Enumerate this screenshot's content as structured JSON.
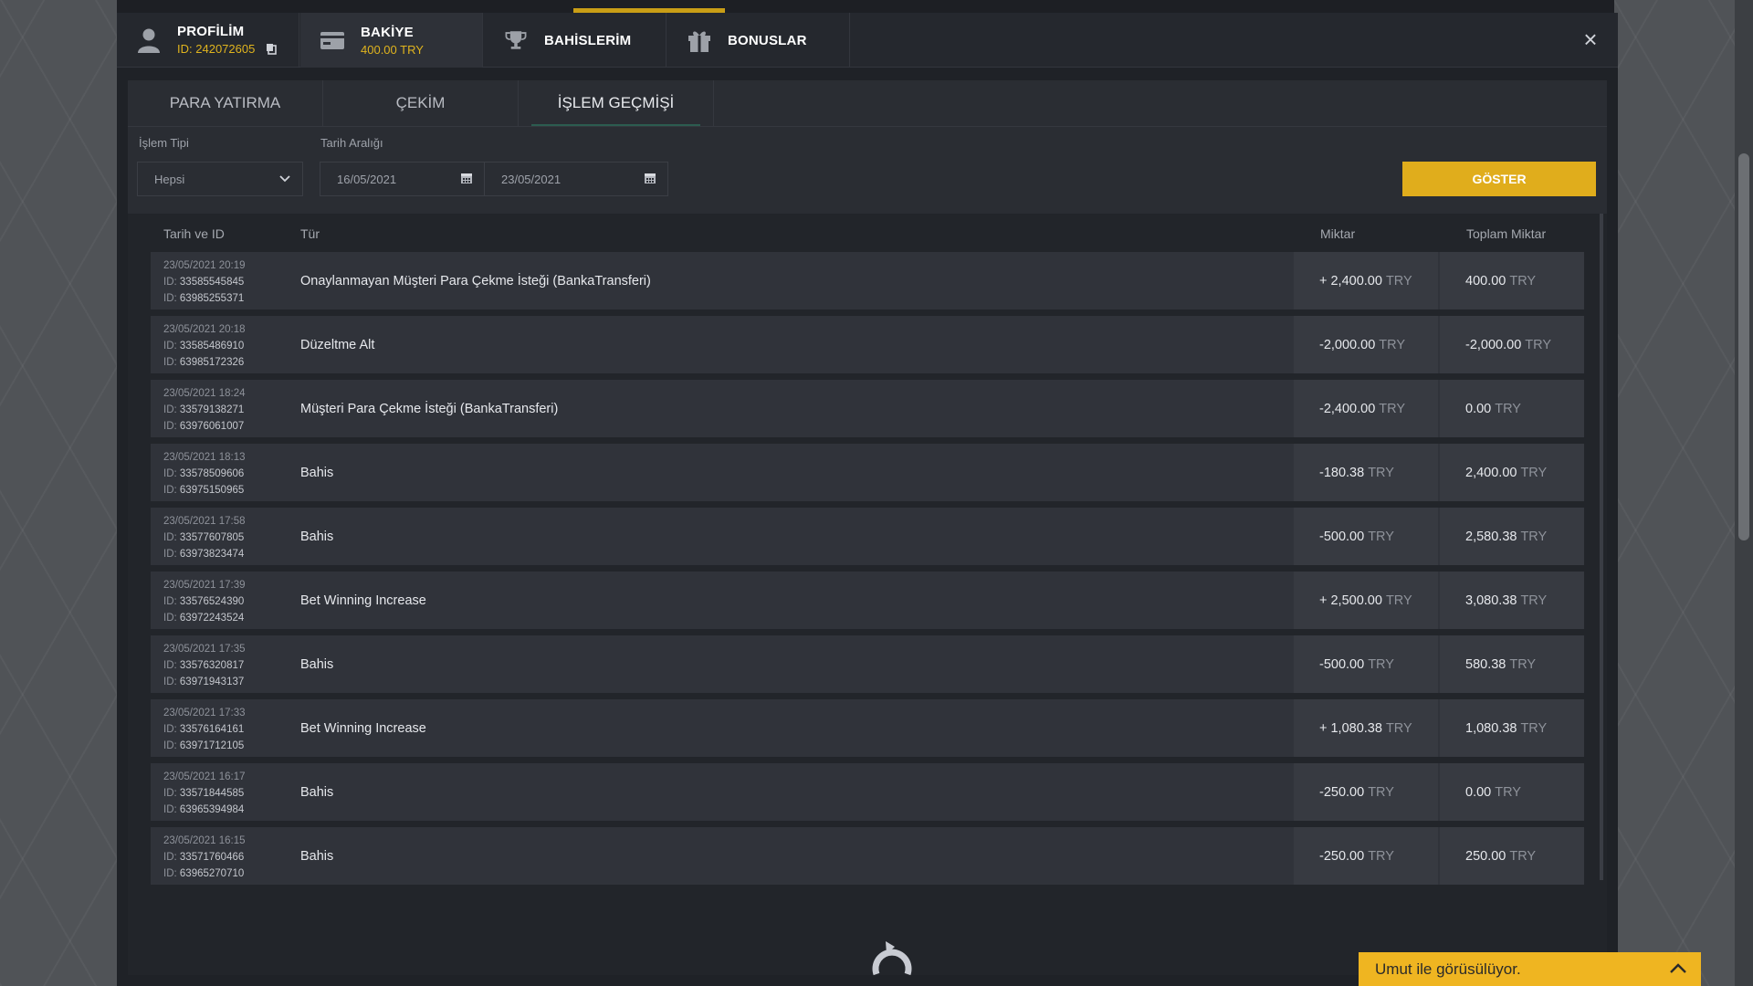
{
  "header": {
    "profile": {
      "label": "PROFİLİM",
      "id_prefix": "ID:",
      "id_value": "242072605"
    },
    "balance": {
      "label": "BAKİYE",
      "amount": "400.00 TRY"
    },
    "bets": {
      "label": "BAHİSLERİM"
    },
    "bonuses": {
      "label": "BONUSLAR"
    },
    "close": "×"
  },
  "subtabs": [
    "PARA YATIRMA",
    "ÇEKİM",
    "İŞLEM GEÇMİŞİ"
  ],
  "active_subtab": "İŞLEM GEÇMİŞİ",
  "filters": {
    "type_label": "İşlem Tipi",
    "type_value": "Hepsi",
    "date_label": "Tarih Aralığı",
    "date_from": "16/05/2021",
    "date_to": "23/05/2021",
    "show_button": "GÖSTER"
  },
  "table": {
    "headers": {
      "date": "Tarih ve ID",
      "type": "Tür",
      "amount": "Miktar",
      "total": "Toplam Miktar"
    },
    "currency": "TRY",
    "id_prefix": "ID:",
    "rows": [
      {
        "date": "23/05/2021 20:19",
        "id1": "33585545845",
        "id2": "63985255371",
        "type": "Onaylanmayan Müşteri Para Çekme İsteği (BankaTransferi)",
        "amount": "+ 2,400.00",
        "total": "400.00"
      },
      {
        "date": "23/05/2021 20:18",
        "id1": "33585486910",
        "id2": "63985172326",
        "type": "Düzeltme Alt",
        "amount": "-2,000.00",
        "total": "-2,000.00"
      },
      {
        "date": "23/05/2021 18:24",
        "id1": "33579138271",
        "id2": "63976061007",
        "type": "Müşteri Para Çekme İsteği (BankaTransferi)",
        "amount": "-2,400.00",
        "total": "0.00"
      },
      {
        "date": "23/05/2021 18:13",
        "id1": "33578509606",
        "id2": "63975150965",
        "type": "Bahis",
        "amount": "-180.38",
        "total": "2,400.00"
      },
      {
        "date": "23/05/2021 17:58",
        "id1": "33577607805",
        "id2": "63973823474",
        "type": "Bahis",
        "amount": "-500.00",
        "total": "2,580.38"
      },
      {
        "date": "23/05/2021 17:39",
        "id1": "33576524390",
        "id2": "63972243524",
        "type": "Bet Winning Increase",
        "amount": "+ 2,500.00",
        "total": "3,080.38"
      },
      {
        "date": "23/05/2021 17:35",
        "id1": "33576320817",
        "id2": "63971943137",
        "type": "Bahis",
        "amount": "-500.00",
        "total": "580.38"
      },
      {
        "date": "23/05/2021 17:33",
        "id1": "33576164161",
        "id2": "63971712105",
        "type": "Bet Winning Increase",
        "amount": "+ 1,080.38",
        "total": "1,080.38"
      },
      {
        "date": "23/05/2021 16:17",
        "id1": "33571844585",
        "id2": "63965394984",
        "type": "Bahis",
        "amount": "-250.00",
        "total": "0.00"
      },
      {
        "date": "23/05/2021 16:15",
        "id1": "33571760466",
        "id2": "63965270710",
        "type": "Bahis",
        "amount": "-250.00",
        "total": "250.00"
      }
    ]
  },
  "chat": {
    "text": "Umut ile görüsülüyor."
  },
  "icons": [
    "user-icon",
    "copy-icon",
    "wallet-icon",
    "trophy-icon",
    "gift-icon",
    "close-icon",
    "chevron-down-icon",
    "calendar-icon",
    "refresh-icon",
    "chevron-up-icon"
  ],
  "colors": {
    "accent": "#e0ad1c",
    "balance_text": "#e0b41e",
    "panel": "#2a2d33",
    "row": "#30333a"
  }
}
